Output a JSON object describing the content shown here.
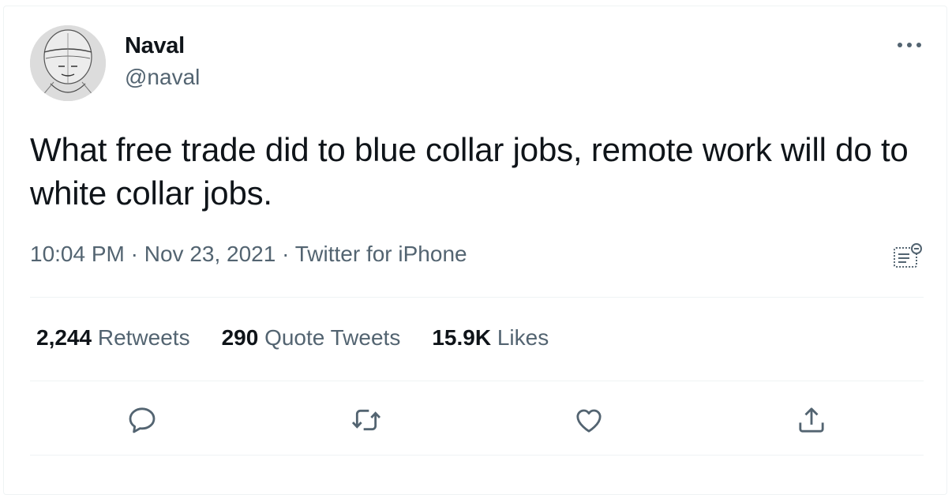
{
  "author": {
    "name": "Naval",
    "handle": "@naval",
    "avatar_icon": "sketched-face-avatar"
  },
  "tweet": {
    "text": "What free trade did to blue collar jobs, remote work will do to white collar jobs.",
    "time": "10:04 PM",
    "separator": " · ",
    "date": "Nov 23, 2021",
    "source": "Twitter for iPhone"
  },
  "stats": {
    "retweets_count": "2,244",
    "retweets_label": "Retweets",
    "quotes_count": "290",
    "quotes_label": "Quote Tweets",
    "likes_count": "15.9K",
    "likes_label": "Likes"
  },
  "actions": [
    "reply-icon",
    "retweet-icon",
    "like-icon",
    "share-icon"
  ],
  "colors": {
    "text": "#0f1419",
    "secondary": "#536471",
    "divider": "#eff3f4"
  }
}
